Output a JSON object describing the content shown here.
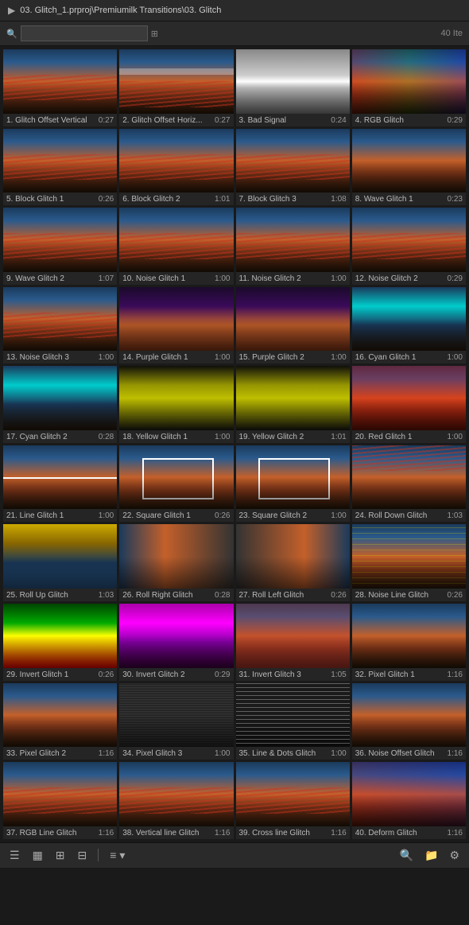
{
  "titlebar": {
    "icon": "▶",
    "path": "03. Glitch_1.prproj\\Premiumilk Transitions\\03. Glitch"
  },
  "search": {
    "placeholder": "",
    "value": ""
  },
  "count": "40 Ite",
  "items": [
    {
      "id": 1,
      "name": "1. Glitch Offset Vertical",
      "duration": "0:27",
      "thumb": "sunset"
    },
    {
      "id": 2,
      "name": "2. Glitch Offset Horiz...",
      "duration": "0:27",
      "thumb": "glitch-h"
    },
    {
      "id": 3,
      "name": "3. Bad Signal",
      "duration": "0:24",
      "thumb": "signal"
    },
    {
      "id": 4,
      "name": "4. RGB Glitch",
      "duration": "0:29",
      "thumb": "rgb"
    },
    {
      "id": 5,
      "name": "5. Block Glitch 1",
      "duration": "0:26",
      "thumb": "sunset"
    },
    {
      "id": 6,
      "name": "6. Block Glitch 2",
      "duration": "1:01",
      "thumb": "sunset"
    },
    {
      "id": 7,
      "name": "7. Block Glitch 3",
      "duration": "1:08",
      "thumb": "sunset"
    },
    {
      "id": 8,
      "name": "8. Wave Glitch 1",
      "duration": "0:23",
      "thumb": "wave"
    },
    {
      "id": 9,
      "name": "9. Wave Glitch 2",
      "duration": "1:07",
      "thumb": "sunset"
    },
    {
      "id": 10,
      "name": "10. Noise Glitch 1",
      "duration": "1:00",
      "thumb": "sunset"
    },
    {
      "id": 11,
      "name": "11. Noise Glitch 2",
      "duration": "1:00",
      "thumb": "sunset"
    },
    {
      "id": 12,
      "name": "12. Noise Glitch 2",
      "duration": "0:29",
      "thumb": "sunset"
    },
    {
      "id": 13,
      "name": "13. Noise Glitch 3",
      "duration": "1:00",
      "thumb": "sunset"
    },
    {
      "id": 14,
      "name": "14. Purple Glitch 1",
      "duration": "1:00",
      "thumb": "purple"
    },
    {
      "id": 15,
      "name": "15. Purple Glitch 2",
      "duration": "1:00",
      "thumb": "purple"
    },
    {
      "id": 16,
      "name": "16. Cyan Glitch 1",
      "duration": "1:00",
      "thumb": "cyan"
    },
    {
      "id": 17,
      "name": "17. Cyan Glitch 2",
      "duration": "0:28",
      "thumb": "cyan"
    },
    {
      "id": 18,
      "name": "18. Yellow Glitch 1",
      "duration": "1:00",
      "thumb": "yellow"
    },
    {
      "id": 19,
      "name": "19. Yellow Glitch 2",
      "duration": "1:01",
      "thumb": "yellow"
    },
    {
      "id": 20,
      "name": "20. Red Glitch 1",
      "duration": "1:00",
      "thumb": "red"
    },
    {
      "id": 21,
      "name": "21. Line Glitch 1",
      "duration": "1:00",
      "thumb": "line"
    },
    {
      "id": 22,
      "name": "22. Square Glitch 1",
      "duration": "0:26",
      "thumb": "square"
    },
    {
      "id": 23,
      "name": "23. Square Glitch 2",
      "duration": "1:00",
      "thumb": "square"
    },
    {
      "id": 24,
      "name": "24. Roll Down Glitch",
      "duration": "1:03",
      "thumb": "roll"
    },
    {
      "id": 25,
      "name": "25. Roll Up Glitch",
      "duration": "1:03",
      "thumb": "rollup"
    },
    {
      "id": 26,
      "name": "26. Roll Right Glitch",
      "duration": "0:28",
      "thumb": "rollright"
    },
    {
      "id": 27,
      "name": "27. Roll Left Glitch",
      "duration": "0:26",
      "thumb": "rollleft"
    },
    {
      "id": 28,
      "name": "28. Noise Line Glitch",
      "duration": "0:26",
      "thumb": "noiseline"
    },
    {
      "id": 29,
      "name": "29. Invert Glitch 1",
      "duration": "0:26",
      "thumb": "invert1"
    },
    {
      "id": 30,
      "name": "30. Invert Glitch 2",
      "duration": "0:29",
      "thumb": "invert2"
    },
    {
      "id": 31,
      "name": "31. Invert Glitch 3",
      "duration": "1:05",
      "thumb": "invert3"
    },
    {
      "id": 32,
      "name": "32. Pixel Glitch 1",
      "duration": "1:16",
      "thumb": "pixel"
    },
    {
      "id": 33,
      "name": "33. Pixel Glitch 2",
      "duration": "1:16",
      "thumb": "pixel"
    },
    {
      "id": 34,
      "name": "34. Pixel Glitch 3",
      "duration": "1:00",
      "thumb": "noise"
    },
    {
      "id": 35,
      "name": "35. Line & Dots Glitch",
      "duration": "1:00",
      "thumb": "dots"
    },
    {
      "id": 36,
      "name": "36. Noise Offset Glitch",
      "duration": "1:16",
      "thumb": "noiseoffset"
    },
    {
      "id": 37,
      "name": "37. RGB Line Glitch",
      "duration": "1:16",
      "thumb": "sunset"
    },
    {
      "id": 38,
      "name": "38. Vertical line Glitch",
      "duration": "1:16",
      "thumb": "sunset"
    },
    {
      "id": 39,
      "name": "39. Cross line Glitch",
      "duration": "1:16",
      "thumb": "sunset"
    },
    {
      "id": 40,
      "name": "40. Deform Glitch",
      "duration": "1:16",
      "thumb": "deform"
    }
  ],
  "toolbar": {
    "view_list": "☰",
    "view_grid": "⊞",
    "view_icon": "▦",
    "sort": "≡",
    "sort_label": "Sort",
    "search_icon": "🔍",
    "folder_icon": "📁",
    "settings_icon": "⚙"
  }
}
